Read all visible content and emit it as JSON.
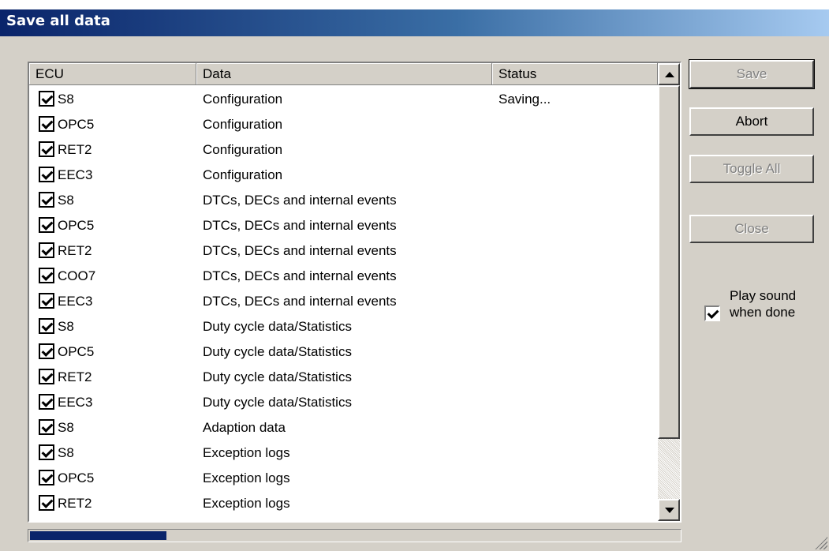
{
  "window": {
    "title": "Save all data"
  },
  "columns": {
    "ecu": "ECU",
    "data": "Data",
    "status": "Status"
  },
  "rows": [
    {
      "checked": true,
      "ecu": "S8",
      "data": "Configuration",
      "status": "Saving..."
    },
    {
      "checked": true,
      "ecu": "OPC5",
      "data": "Configuration",
      "status": ""
    },
    {
      "checked": true,
      "ecu": "RET2",
      "data": "Configuration",
      "status": ""
    },
    {
      "checked": true,
      "ecu": "EEC3",
      "data": "Configuration",
      "status": ""
    },
    {
      "checked": true,
      "ecu": "S8",
      "data": "DTCs, DECs and internal events",
      "status": ""
    },
    {
      "checked": true,
      "ecu": "OPC5",
      "data": "DTCs, DECs and internal events",
      "status": ""
    },
    {
      "checked": true,
      "ecu": "RET2",
      "data": "DTCs, DECs and internal events",
      "status": ""
    },
    {
      "checked": true,
      "ecu": "COO7",
      "data": "DTCs, DECs and internal events",
      "status": ""
    },
    {
      "checked": true,
      "ecu": "EEC3",
      "data": "DTCs, DECs and internal events",
      "status": ""
    },
    {
      "checked": true,
      "ecu": "S8",
      "data": "Duty cycle data/Statistics",
      "status": ""
    },
    {
      "checked": true,
      "ecu": "OPC5",
      "data": "Duty cycle data/Statistics",
      "status": ""
    },
    {
      "checked": true,
      "ecu": "RET2",
      "data": "Duty cycle data/Statistics",
      "status": ""
    },
    {
      "checked": true,
      "ecu": "EEC3",
      "data": "Duty cycle data/Statistics",
      "status": ""
    },
    {
      "checked": true,
      "ecu": "S8",
      "data": "Adaption data",
      "status": ""
    },
    {
      "checked": true,
      "ecu": "S8",
      "data": "Exception logs",
      "status": ""
    },
    {
      "checked": true,
      "ecu": "OPC5",
      "data": "Exception logs",
      "status": ""
    },
    {
      "checked": true,
      "ecu": "RET2",
      "data": "Exception logs",
      "status": ""
    }
  ],
  "buttons": {
    "save": {
      "label": "Save",
      "enabled": false
    },
    "abort": {
      "label": "Abort",
      "enabled": true
    },
    "toggle_all": {
      "label": "Toggle All",
      "enabled": false
    },
    "close": {
      "label": "Close",
      "enabled": false
    }
  },
  "play_sound": {
    "label_line1": "Play sound",
    "label_line2": "when done",
    "checked": true
  },
  "progress": {
    "fraction": 0.21
  },
  "colors": {
    "title_gradient_start": "#0a246a",
    "title_gradient_end": "#a6caf0",
    "progress_fill": "#0a246a",
    "face": "#d4d0c8"
  }
}
